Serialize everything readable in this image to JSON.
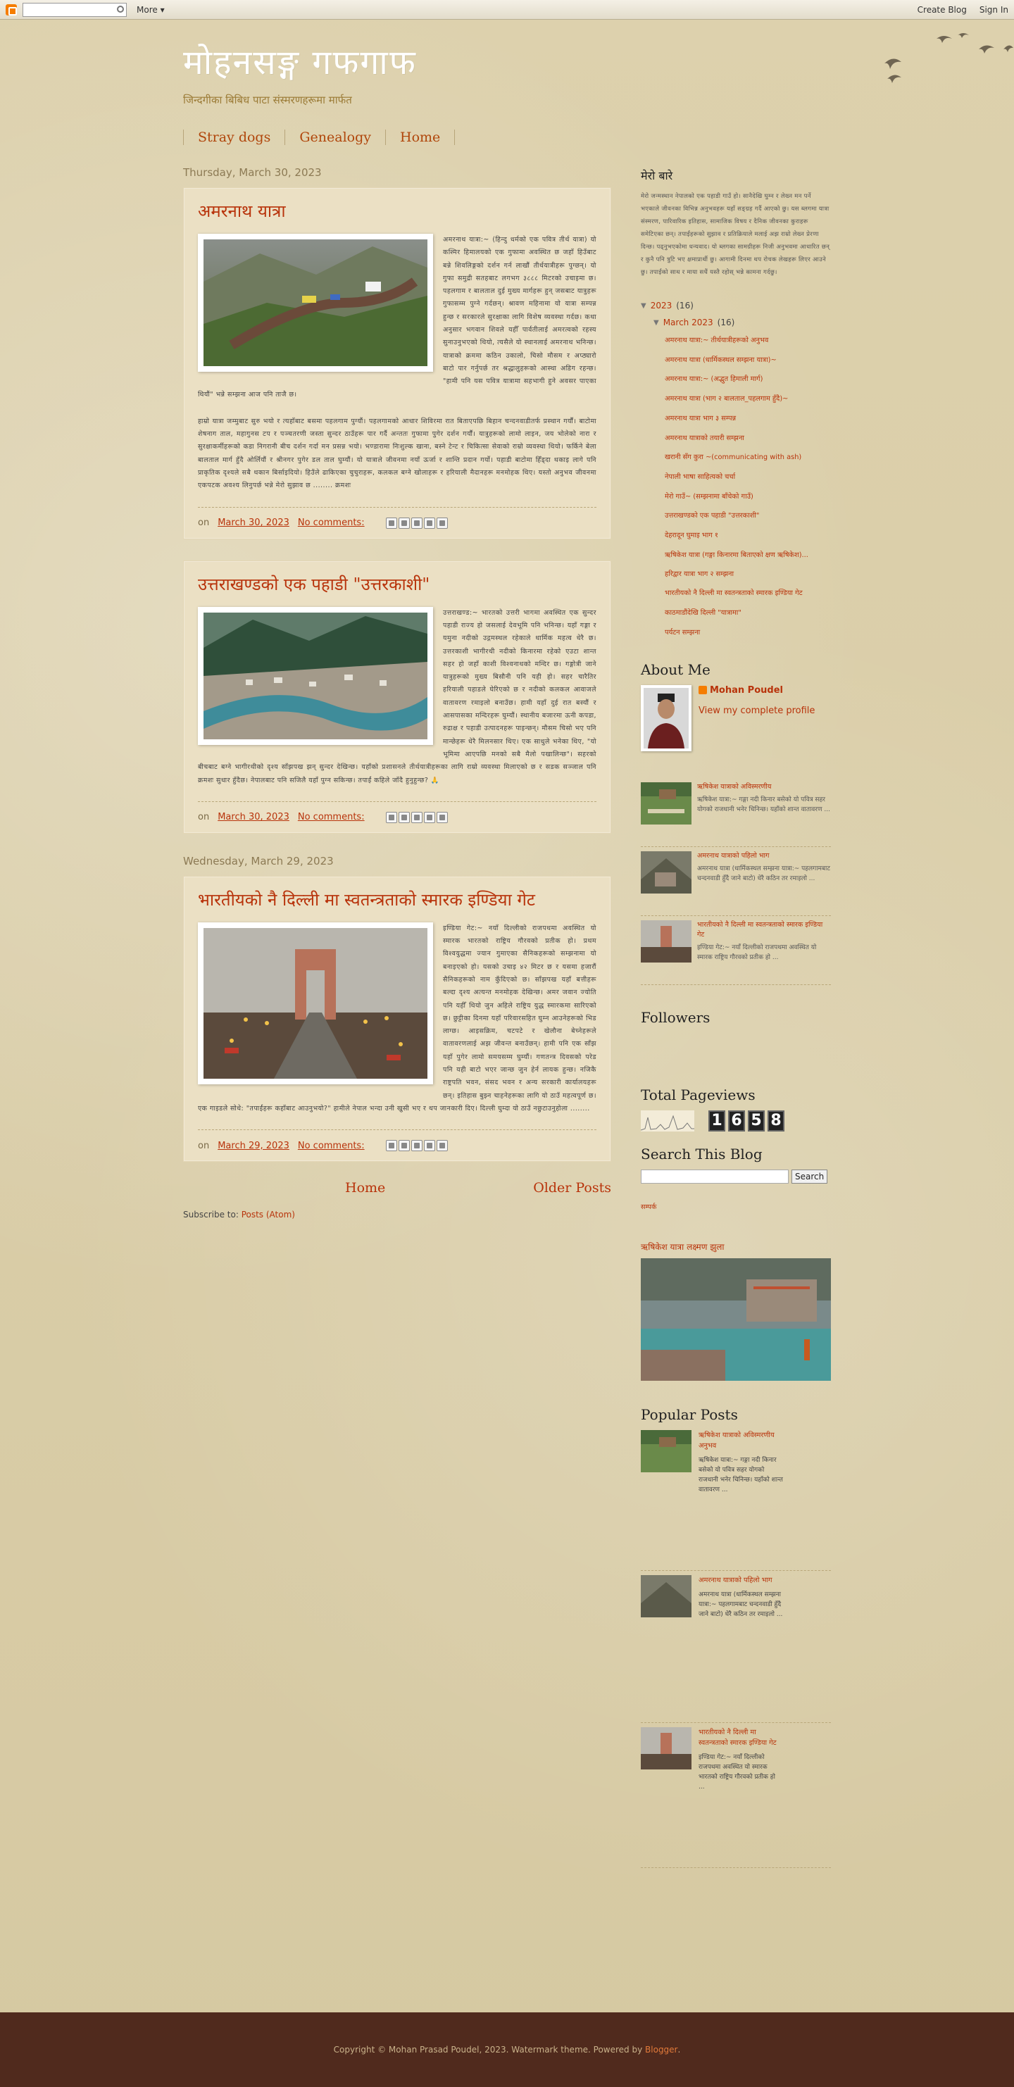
{
  "navbar": {
    "more_label": "More ▾",
    "create_blog": "Create Blog",
    "sign_in": "Sign In"
  },
  "header": {
    "title": "मोहनसङ्ग गफगाफ",
    "description": "जिन्दगीका बिबिध पाटा संस्मरणहरूमा मार्फत"
  },
  "tabs": [
    {
      "label": "Stray dogs"
    },
    {
      "label": "Genealogy"
    },
    {
      "label": "Home"
    }
  ],
  "posts": [
    {
      "date_header": "Thursday, March 30, 2023",
      "title": "अमरनाथ यात्रा",
      "body_1": "अमरनाथ यात्रा:~ (हिन्दु धर्मको एक पवित्र तीर्थ यात्रा) यो कश्मिर हिमालयको एक गुफामा अवस्थित छ जहाँ हिउँबाट बन्ने शिवलिङ्गको दर्शन गर्न लाखौं तीर्थयात्रीहरू पुग्छन्। यो गुफा समुद्री सतहबाट लगभग ३८८८ मिटरको उचाइमा छ। पहलगाम र बालताल दुई मुख्य मार्गहरू हुन् जसबाट यात्रुहरू गुफासम्म पुग्ने गर्दछन्। श्रावण महिनामा यो यात्रा सम्पन्न हुन्छ र सरकारले सुरक्षाका लागि विशेष व्यवस्था गर्दछ। कथा अनुसार भगवान शिवले यहीँ पार्वतीलाई अमरत्वको रहस्य सुनाउनुभएको थियो, त्यसैले यो स्थानलाई अमरनाथ भनिन्छ। यात्राको क्रममा कठिन उकालो, चिसो मौसम र अप्ठ्यारो बाटो पार गर्नुपर्छ तर श्रद्धालुहरूको आस्था अडिग रहन्छ। \"हामी पनि यस पवित्र यात्रामा सहभागी हुने अवसर पाएका थियौं\" भन्ने सम्झना आज पनि ताजै छ।",
      "body_2": "हाम्रो यात्रा जम्मुबाट सुरु भयो र त्यहाँबाट बसमा पहलगाम पुग्यौं। पहलगामको आधार शिविरमा रात बिताएपछि बिहान चन्दनवाडीतर्फ प्रस्थान गर्यौं। बाटोमा शेषनाग ताल, महागुनस टप र पञ्चतरणी जस्ता सुन्दर ठाउँहरू पार गर्दै अन्ततः गुफामा पुगेर दर्शन गर्यौं। यात्रुहरूको लामो लाइन, जय भोलेको नारा र सुरक्षाकर्मीहरूको कडा निगरानी बीच दर्शन गर्दा मन प्रसन्न भयो। भण्डारामा निःशुल्क खाना, बस्ने टेन्ट र चिकित्सा सेवाको राम्रो व्यवस्था थियो। फर्किने बेला बालताल मार्ग हुँदै ओर्लियौं र श्रीनगर पुगेर डल ताल घुम्यौं। यो यात्राले जीवनमा नयाँ ऊर्जा र शान्ति प्रदान गर्यो। पहाडी बाटोमा हिँड्दा थकाइ लागे पनि प्राकृतिक दृश्यले सबै थकान बिर्साइदियो। हिउँले ढाकिएका चुचुराहरू, कलकल बग्ने खोलाहरू र हरियाली मैदानहरू मनमोहक थिए। यस्तो अनुभव जीवनमा एकपटक अवश्य लिनुपर्छ भन्ने मेरो सुझाव छ ........ क्रमशः",
      "timestamp": "March 30, 2023",
      "comments": "No comments:"
    },
    {
      "date_header": "",
      "title": "उत्तराखण्डको एक पहाडी \"उत्तरकाशी\"",
      "body_1": "उत्तराखण्ड:~ भारतको उत्तरी भागमा अवस्थित एक सुन्दर पहाडी राज्य हो जसलाई देवभूमि पनि भनिन्छ। यहाँ गङ्गा र यमुना नदीको उद्गमस्थल रहेकाले धार्मिक महत्व धेरै छ। उत्तरकाशी भागीरथी नदीको किनारमा रहेको एउटा शान्त सहर हो जहाँ काशी विश्वनाथको मन्दिर छ। गङ्गोत्री जाने यात्रुहरूको मुख्य बिसौनी पनि यही हो। सहर चारैतिर हरियाली पहाडले घेरिएको छ र नदीको कलकल आवाजले वातावरण रमाइलो बनाउँछ। हामी यहाँ दुई रात बस्यौं र आसपासका मन्दिरहरू घुम्यौं। स्थानीय बजारमा ऊनी कपडा, रुद्राक्ष र पहाडी उत्पादनहरू पाइन्छन्। मौसम चिसो भए पनि मान्छेहरू धेरै मिलनसार थिए। एक साधुले भनेका थिए, \"यो भूमिमा आएपछि मनको सबै मैलो पखालिन्छ\"। सहरको बीचबाट बग्ने भागीरथीको दृश्य साँझपख झन् सुन्दर देखिन्छ। यहाँको प्रशासनले तीर्थयात्रीहरूका लागि राम्रो व्यवस्था मिलाएको छ र सडक सञ्जाल पनि क्रमशः सुधार हुँदैछ। नेपालबाट पनि सजिलै यहाँ पुग्न सकिन्छ। तपाईं कहिले जाँदै हुनुहुन्छ? 🙏",
      "timestamp": "March 30, 2023",
      "comments": "No comments:"
    },
    {
      "date_header": "Wednesday, March 29, 2023",
      "title": "भारतीयको नै दिल्ली मा स्वतन्त्रताको स्मारक इण्डिया गेट",
      "body_1": "इण्डिया गेट:~ नयाँ दिल्लीको राजपथमा अवस्थित यो स्मारक भारतको राष्ट्रिय गौरवको प्रतीक हो। प्रथम विश्वयुद्धमा ज्यान गुमाएका सैनिकहरूको सम्झनामा यो बनाइएको हो। यसको उचाइ ४२ मिटर छ र यसमा हजारौं सैनिकहरूको नाम कुँदिएको छ। साँझपख यहाँ बत्तीहरू बल्दा दृश्य अत्यन्त मनमोहक देखिन्छ। अमर जवान ज्योति पनि यहीँ थियो जुन अहिले राष्ट्रिय युद्ध स्मारकमा सारिएको छ। छुट्टीका दिनमा यहाँ परिवारसहित घुम्न आउनेहरूको भिड लाग्छ। आइसक्रिम, चटपटे र खेलौना बेच्नेहरूले वातावरणलाई अझ जीवन्त बनाउँछन्। हामी पनि एक साँझ यहाँ पुगेर लामो समयसम्म घुम्यौं। गणतन्त्र दिवसको परेड पनि यही बाटो भएर जान्छ जुन हेर्न लायक हुन्छ। नजिकै राष्ट्रपति भवन, संसद भवन र अन्य सरकारी कार्यालयहरू छन्। इतिहास बुझ्न चाहनेहरूका लागि यो ठाउँ महत्वपूर्ण छ। एक गाइडले सोधे: \"तपाईंहरू कहाँबाट आउनुभयो?\" हामीले नेपाल भन्दा उनी खुसी भए र थप जानकारी दिए। दिल्ली घुम्दा यो ठाउँ नछुटाउनुहोला ........",
      "timestamp": "March 29, 2023",
      "comments": "No comments:"
    }
  ],
  "pager": {
    "home": "Home",
    "older": "Older Posts"
  },
  "subscribe": {
    "label": "Subscribe to:",
    "link": "Posts (Atom)"
  },
  "sidebar": {
    "about_title": "मेरो बारे",
    "about_text": "मेरो जन्मस्थान नेपालको एक पहाडी गाउँ हो। सानैदेखि घुम्न र लेख्न मन पर्ने भएकाले जीवनका विभिन्न अनुभवहरू यहाँ सङ्ग्रह गर्दै आएको छु। यस ब्लगमा यात्रा संस्मरण, पारिवारिक इतिहास, सामाजिक विषय र दैनिक जीवनका कुराहरू समेटिएका छन्। तपाईंहरूको सुझाव र प्रतिक्रियाले मलाई अझ राम्रो लेख्न प्रेरणा दिन्छ। पढ्नुभएकोमा धन्यवाद। यो ब्लगका सामग्रीहरू निजी अनुभवमा आधारित छन् र कुनै पनि त्रुटि भए क्षमाप्रार्थी छु। आगामी दिनमा थप रोचक लेखहरू लिएर आउने छु। तपाईंको साथ र माया सधैं यस्तै रहोस् भन्ने कामना गर्दछु।",
    "archive": {
      "year": "2023",
      "year_count": "(16)",
      "month": "March 2023",
      "month_count": "(16)",
      "items": [
        "अमरनाथ यात्रा:~ तीर्थयात्रीहरूको अनुभव",
        "अमरनाथ यात्रा (धार्मिकस्थल सम्झना यात्रा)~",
        "अमरनाथ यात्रा:~ (अद्भुत हिमाली मार्ग)",
        "अमरनाथ यात्रा (भाग २ बालताल_पहलगाम हुँदै)~",
        "अमरनाथ यात्रा भाग ३ सम्पन्न",
        "अमरनाथ यात्राको तयारी सम्झना",
        "खरानी सँग कुरा ~(communicating with ash)",
        "नेपाली भाषा साहित्यको चर्चा",
        "मेरो गाउँ~ (सम्झनामा बाँचेको गाउँ)",
        "उत्तराखण्डको एक पहाडी \"उत्तरकाशी\"",
        "देहरादून घुमाइ भाग १",
        "ऋषिकेश यात्रा (गङ्गा किनारमा बिताएको क्षण ऋषिकेश)...",
        "हरिद्वार यात्रा भाग २ सम्झना",
        "भारतीयको नै दिल्ली मा स्वतन्त्रताको स्मारक इण्डिया गेट",
        "काठमाडौंदेखि दिल्ली \"यात्रामा\"",
        "पर्यटन सम्झना"
      ]
    },
    "about_me": {
      "title": "About Me",
      "name": "Mohan Poudel",
      "profile_link": "View my complete profile"
    },
    "related": [
      {
        "title": "ऋषिकेश यात्राको अविस्मरणीय",
        "snippet": "ऋषिकेश यात्रा:~ गङ्गा नदी किनार बसेको यो पवित्र सहर योगको राजधानी भनेर चिनिन्छ। यहाँको शान्त वातावरण ..."
      },
      {
        "title": "अमरनाथ यात्राको पहिलो भाग",
        "snippet": "अमरनाथ यात्रा (धार्मिकस्थल सम्झना यात्रा:~ पहलगामबाट चन्दनवाडी हुँदै जाने बाटो) धेरै कठिन तर रमाइलो ..."
      },
      {
        "title": "भारतीयको नै दिल्ली मा स्वतन्त्रताको स्मारक इण्डिया गेट",
        "snippet": "इण्डिया गेट:~ नयाँ दिल्लीको राजपथमा अवस्थित यो स्मारक राष्ट्रिय गौरवको प्रतीक हो ..."
      }
    ],
    "followers_title": "Followers",
    "pageviews": {
      "title": "Total Pageviews",
      "digits": [
        "1",
        "6",
        "5",
        "8"
      ]
    },
    "search": {
      "title": "Search This Blog",
      "button": "Search"
    },
    "text_link": "सम्पर्क",
    "featured": {
      "title": "ऋषिकेश यात्रा लक्ष्मण झुला"
    },
    "popular": {
      "title": "Popular Posts",
      "items": [
        {
          "title": "ऋषिकेश यात्राको अविस्मरणीय अनुभव",
          "snippet": "ऋषिकेश यात्रा:~ गङ्गा नदी किनार बसेको यो पवित्र सहर योगको राजधानी भनेर चिनिन्छ। यहाँको शान्त वातावरण ..."
        },
        {
          "title": "अमरनाथ यात्राको पहिलो भाग",
          "snippet": "अमरनाथ यात्रा (धार्मिकस्थल सम्झना यात्रा:~ पहलगामबाट चन्दनवाडी हुँदै जाने बाटो) धेरै कठिन तर रमाइलो ..."
        },
        {
          "title": "भारतीयको नै दिल्ली मा स्वतन्त्रताको स्मारक इण्डिया गेट",
          "snippet": "इण्डिया गेट:~ नयाँ दिल्लीको राजपथमा अवस्थित यो स्मारक भारतको राष्ट्रिय गौरवको प्रतीक हो ..."
        }
      ]
    }
  },
  "footer": {
    "text": "Copyright © Mohan Prasad Poudel, 2023. Watermark theme. Powered by ",
    "link": "Blogger",
    "tail": "."
  },
  "colors": {
    "accent": "#b8330b",
    "footer_bg": "#502a1d",
    "post_bg": "#ebe0c4"
  }
}
